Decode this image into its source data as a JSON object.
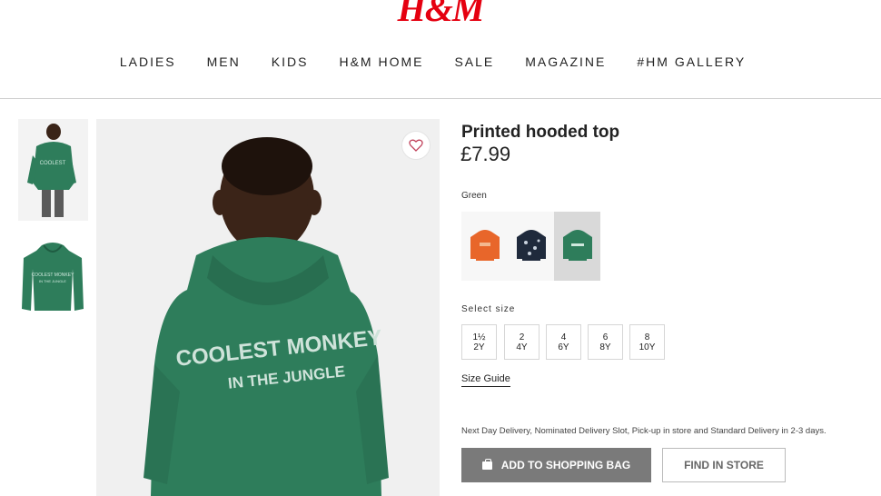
{
  "brand": {
    "logo_text": "H&M",
    "logo_color": "#e50010"
  },
  "nav": {
    "items": [
      {
        "label": "LADIES"
      },
      {
        "label": "MEN"
      },
      {
        "label": "KIDS"
      },
      {
        "label": "H&M HOME"
      },
      {
        "label": "SALE"
      },
      {
        "label": "MAGAZINE"
      },
      {
        "label": "#HM GALLERY"
      }
    ]
  },
  "gallery": {
    "print_line1": "COOLEST MONKEY",
    "print_line2": "IN THE JUNGLE",
    "hoodie_color": "#2e7d5b"
  },
  "product": {
    "title": "Printed hooded top",
    "price": "£7.99",
    "selected_color": "Green",
    "swatches": [
      {
        "color": "#e8662a"
      },
      {
        "color": "#1f2a3c"
      },
      {
        "color": "#2e7d5b",
        "selected": true
      }
    ]
  },
  "size": {
    "label": "Select size",
    "options": [
      {
        "line1": "1½",
        "line2": "2Y"
      },
      {
        "line1": "2",
        "line2": "4Y"
      },
      {
        "line1": "4",
        "line2": "6Y"
      },
      {
        "line1": "6",
        "line2": "8Y"
      },
      {
        "line1": "8",
        "line2": "10Y"
      }
    ],
    "guide_label": "Size Guide"
  },
  "delivery_text": "Next Day Delivery, Nominated Delivery Slot, Pick-up in store and Standard Delivery in 2-3 days.",
  "actions": {
    "add_to_bag": "ADD TO SHOPPING BAG",
    "find_in_store": "FIND IN STORE"
  }
}
